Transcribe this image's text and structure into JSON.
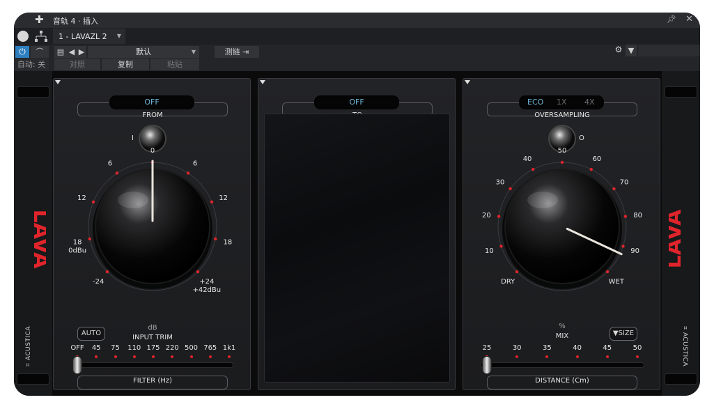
{
  "window": {
    "title": "音轨 4 · 插入"
  },
  "toolbar": {
    "insert_slot": "1 - LAVAZL 2",
    "preset": "默认",
    "sidechain": "测链",
    "auto": "自动: 关",
    "compare": "对照",
    "copy": "复制",
    "paste": "粘贴"
  },
  "left_panel": {
    "from_value": "OFF",
    "from_label": "FROM",
    "switch_label": "I",
    "knob_ticks": [
      "0",
      "6",
      "6",
      "12",
      "12",
      "18",
      "18",
      "-24",
      "+24"
    ],
    "tick_left_sub": "0dBu",
    "tick_right_sub": "+42dBu",
    "unit": "dB",
    "knob_label": "INPUT TRIM",
    "auto_button": "AUTO",
    "filter_ticks": [
      "OFF",
      "45",
      "75",
      "110",
      "175",
      "220",
      "500",
      "765",
      "1k1"
    ],
    "filter_label": "FILTER (Hz)",
    "input_trim_value": 0,
    "filter_value": "OFF"
  },
  "middle_panel": {
    "to_value": "OFF",
    "to_label": "TO"
  },
  "right_panel": {
    "oversampling_options": [
      "ECO",
      "1X",
      "4X"
    ],
    "oversampling_selected": "ECO",
    "oversampling_label": "OVERSAMPLING",
    "switch_label": "O",
    "mix_ticks": [
      "50",
      "40",
      "60",
      "30",
      "70",
      "20",
      "80",
      "10",
      "90",
      "DRY",
      "WET"
    ],
    "unit": "%",
    "knob_label": "MIX",
    "size_button": "▼SIZE",
    "distance_ticks": [
      "25",
      "30",
      "35",
      "40",
      "45",
      "50"
    ],
    "distance_label": "DISTANCE (Cm)",
    "mix_value": 100,
    "distance_value": 25
  },
  "brand": {
    "logo": "LAVA",
    "maker": "ACUSTICA"
  },
  "colors": {
    "accent_red": "#e0242b",
    "display_blue": "#6fb7d8",
    "power_blue": "#2d7fbf"
  }
}
